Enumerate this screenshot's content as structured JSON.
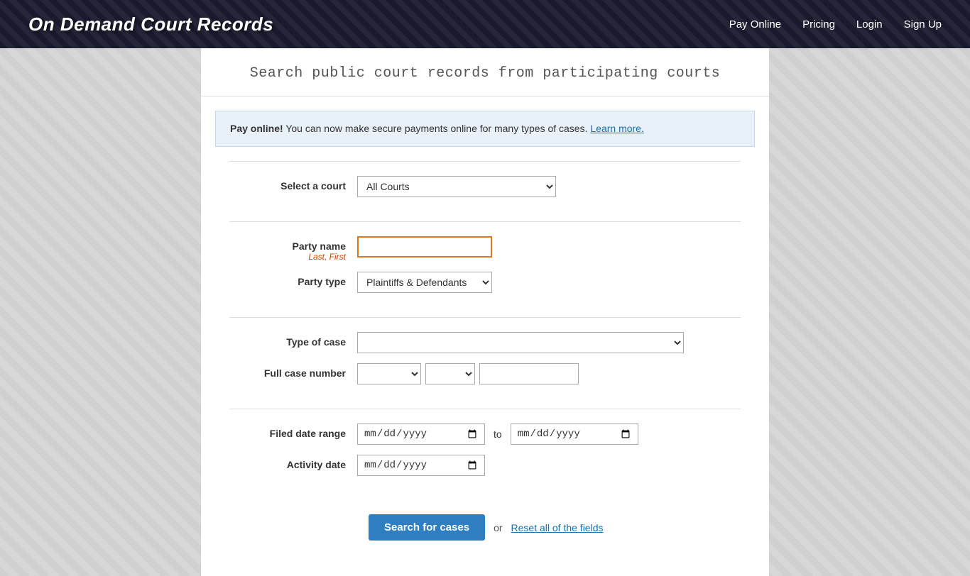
{
  "header": {
    "logo": "On Demand Court Records",
    "nav": {
      "pay_online": "Pay Online",
      "pricing": "Pricing",
      "login": "Login",
      "sign_up": "Sign Up"
    }
  },
  "page": {
    "title": "Search public court records from participating courts"
  },
  "notice": {
    "bold_text": "Pay online!",
    "text": " You can now make secure payments online for many types of cases.",
    "link_text": "Learn more."
  },
  "form": {
    "court_select_label": "Select a court",
    "court_default_option": "All Courts",
    "party_name_label": "Party name",
    "party_name_sub": "Last, First",
    "party_name_placeholder": "",
    "party_type_label": "Party type",
    "party_type_default": "Plaintiffs & Defendants",
    "case_type_label": "Type of case",
    "case_number_label": "Full case number",
    "filed_date_label": "Filed date range",
    "date_to_separator": "to",
    "activity_date_label": "Activity date",
    "date_placeholder": "mm/dd/yyyy",
    "search_button_label": "Search for cases",
    "or_text": "or",
    "reset_label": "Reset all of the fields"
  }
}
